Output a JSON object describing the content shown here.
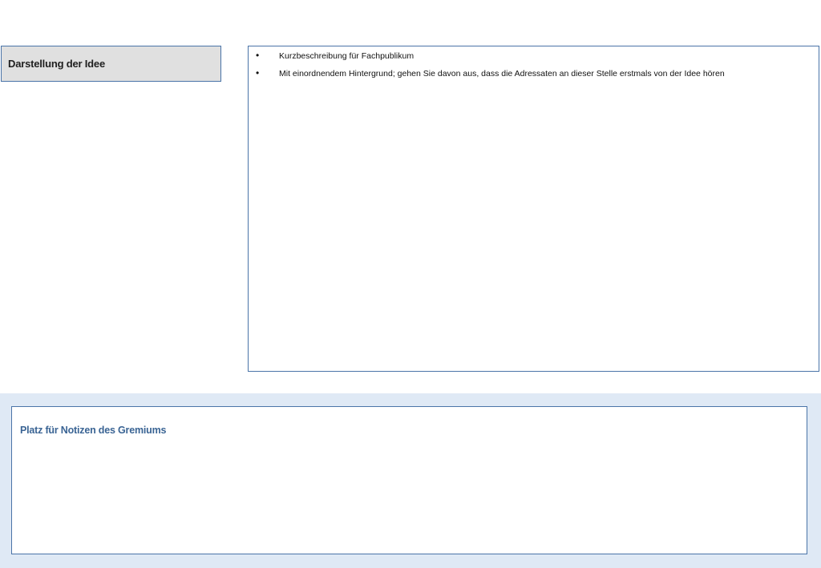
{
  "section": {
    "label": "Darstellung der Idee"
  },
  "content": {
    "bullets": [
      "Kurzbeschreibung für Fachpublikum",
      "Mit einordnendem Hintergrund; gehen Sie davon aus, dass die Adressaten an dieser Stelle erstmals von der Idee hören"
    ]
  },
  "notes": {
    "title": "Platz für Notizen des Gremiums"
  },
  "colors": {
    "border": "#4a74a8",
    "label_bg": "#e0e0e0",
    "notes_band": "#dfe9f5",
    "notes_title": "#3a6494"
  }
}
